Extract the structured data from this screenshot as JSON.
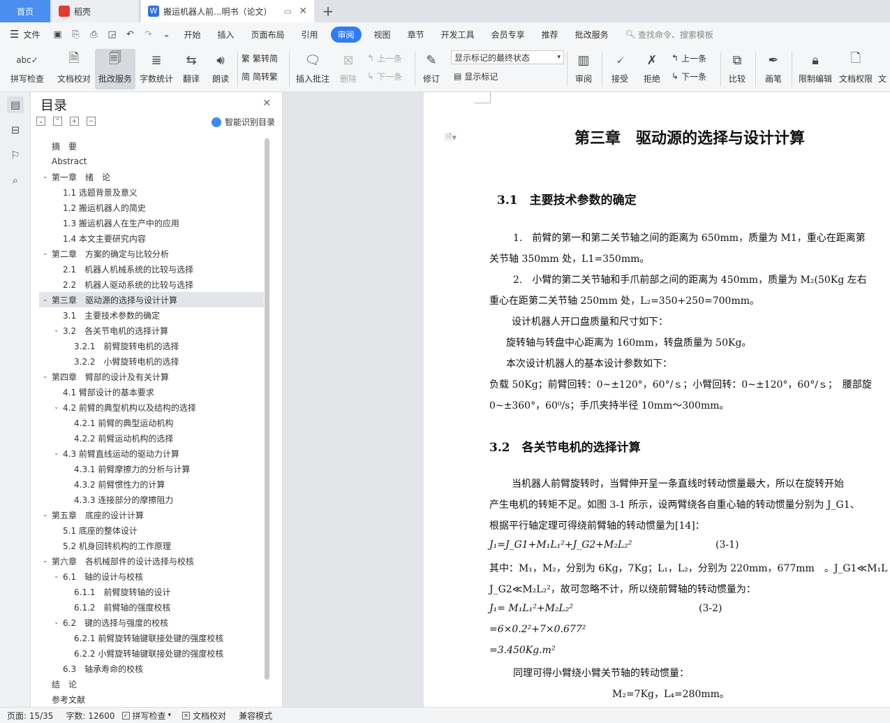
{
  "tabs": {
    "home": "首页",
    "daoke": "稻壳",
    "doc": "搬运机器人前...明书（论文）",
    "plus": "+"
  },
  "menu": {
    "file": "文件",
    "items": [
      "开始",
      "插入",
      "页面布局",
      "引用",
      "审阅",
      "视图",
      "章节",
      "开发工具",
      "会员专享",
      "推荐",
      "批改服务"
    ],
    "search": "查找命令、搜索模板"
  },
  "ribbon": {
    "spell": "拼写检查",
    "doccheck": "文档校对",
    "pigai": "批改服务",
    "wordcount": "字数统计",
    "translate": "翻译",
    "read": "朗读",
    "trad": "繁转简",
    "simp": "简转繁",
    "addcomment": "插入批注",
    "delete": "删除",
    "prev": "上一条",
    "next": "下一条",
    "revise": "修订",
    "markup_select": "显示标记的最终状态",
    "showmark": "显示标记",
    "review": "审阅",
    "accept": "接受",
    "reject": "拒绝",
    "prev2": "上一条",
    "next2": "下一条",
    "compare": "比较",
    "pen": "画笔",
    "restrict": "限制编辑",
    "docperm": "文档权限",
    "cut": "文"
  },
  "toc": {
    "title": "目录",
    "smart": "智能识别目录",
    "items": [
      {
        "text": "摘　要",
        "lvl": 0,
        "arrow": ""
      },
      {
        "text": "Abstract",
        "lvl": 0,
        "arrow": ""
      },
      {
        "text": "第一章　绪　论",
        "lvl": 0,
        "arrow": "v"
      },
      {
        "text": "1.1 选题背景及意义",
        "lvl": 1,
        "arrow": ""
      },
      {
        "text": "1.2  搬运机器人的简史",
        "lvl": 1,
        "arrow": ""
      },
      {
        "text": "1.3 搬运机器人在生产中的应用",
        "lvl": 1,
        "arrow": ""
      },
      {
        "text": "1.4 本文主要研究内容",
        "lvl": 1,
        "arrow": ""
      },
      {
        "text": "第二章　方案的确定与比较分析",
        "lvl": 0,
        "arrow": "v"
      },
      {
        "text": "2.1　机器人机械系统的比较与选择",
        "lvl": 1,
        "arrow": ""
      },
      {
        "text": "2.2　机器人驱动系统的比较与选择",
        "lvl": 1,
        "arrow": ""
      },
      {
        "text": "第三章　驱动源的选择与设计计算",
        "lvl": 0,
        "arrow": "v"
      },
      {
        "text": "3.1　主要技术参数的确定",
        "lvl": 1,
        "arrow": ""
      },
      {
        "text": "3.2　各关节电机的选择计算",
        "lvl": 1,
        "arrow": "v"
      },
      {
        "text": "3.2.1　前臂旋转电机的选择",
        "lvl": 2,
        "arrow": ""
      },
      {
        "text": "3.2.2　小臂旋转电机的选择",
        "lvl": 2,
        "arrow": ""
      },
      {
        "text": "第四章　臂部的设计及有关计算",
        "lvl": 0,
        "arrow": "v"
      },
      {
        "text": "4.1  臂部设计的基本要求",
        "lvl": 1,
        "arrow": ""
      },
      {
        "text": "4.2  前臂的典型机构以及结构的选择",
        "lvl": 1,
        "arrow": "v"
      },
      {
        "text": "4.2.1  前臂的典型运动机构",
        "lvl": 2,
        "arrow": ""
      },
      {
        "text": "4.2.2  前臂运动机构的选择",
        "lvl": 2,
        "arrow": ""
      },
      {
        "text": "4.3  前臂直线运动的驱动力计算",
        "lvl": 1,
        "arrow": "v"
      },
      {
        "text": "4.3.1  前臂摩擦力的分析与计算",
        "lvl": 2,
        "arrow": ""
      },
      {
        "text": "4.3.2  前臂惯性力的计算",
        "lvl": 2,
        "arrow": ""
      },
      {
        "text": "4.3.3 连接部分的摩擦阻力",
        "lvl": 2,
        "arrow": ""
      },
      {
        "text": "第五章　底座的设计计算",
        "lvl": 0,
        "arrow": "v"
      },
      {
        "text": "5.1  底座的整体设计",
        "lvl": 1,
        "arrow": ""
      },
      {
        "text": "5.2  机身回转机构的工作原理",
        "lvl": 1,
        "arrow": ""
      },
      {
        "text": "第六章　各机械部件的设计选择与校核",
        "lvl": 0,
        "arrow": "v"
      },
      {
        "text": "6.1　轴的设计与校核",
        "lvl": 1,
        "arrow": "v"
      },
      {
        "text": "6.1.1　前臂旋转轴的设计",
        "lvl": 2,
        "arrow": ""
      },
      {
        "text": "6.1.2　前臂轴的强度校核",
        "lvl": 2,
        "arrow": ""
      },
      {
        "text": "6.2　键的选择与强度的校核",
        "lvl": 1,
        "arrow": "v"
      },
      {
        "text": "6.2.1 前臂旋转轴键联接处键的强度校核",
        "lvl": 2,
        "arrow": ""
      },
      {
        "text": "6.2.2 小臂旋转轴键联接处键的强度校核",
        "lvl": 2,
        "arrow": ""
      },
      {
        "text": "6.3　轴承寿命的校核",
        "lvl": 1,
        "arrow": ""
      },
      {
        "text": "结　论",
        "lvl": 0,
        "arrow": ""
      },
      {
        "text": "参考文献",
        "lvl": 0,
        "arrow": ""
      }
    ]
  },
  "doc": {
    "chapter": "第三章　驱动源的选择与设计计算",
    "s31": "3.1　主要技术参数的确定",
    "p1": "1.　前臂的第一和第二关节轴之间的距离为 650mm，质量为 M1，重心在距离第",
    "p1b": "关节轴 350mm 处，L1=350mm。",
    "p2": "2.　小臂的第二关节轴和手爪前部之间的距离为 450mm，质量为 M₂(50Kg 左右",
    "p2b": "重心在距第二关节轴 250mm 处，L₂=350+250=700mm。",
    "p3": "设计机器人开口盘质量和尺寸如下：",
    "p4": "旋转轴与转盘中心距离为 160mm，转盘质量为 50Kg。",
    "p5": "本次设计机器人的基本设计参数如下：",
    "p6": "负载 50Kg；前臂回转：0~±120°，60°/ｓ；小臂回转：0~±120°，60°/ｓ；　腰部旋",
    "p7": "0~±360°，60⁰/s；手爪夹持半径 10mm～300mm。",
    "s32": "3.2　各关节电机的选择计算",
    "p8": "当机器人前臂旋转时，当臂伸开呈一条直线时转动惯量最大，所以在旋转开始",
    "p9": "产生电机的转矩不足。如图 3-1 所示，设两臂绕各自重心轴的转动惯量分别为 J_G1、",
    "p10": "根据平行轴定理可得绕前臂轴的转动惯量为[14]：",
    "eq1": "J₁=J_G1+M₁L₁²+J_G2+M₂L₂²",
    "eq1n": "(3-1)",
    "p11": "其中：M₁，M₂，分别为 6Kg，7Kg；L₁，L₂，分别为 220mm，677mm　。J_G1≪M₁L",
    "p12": "J_G2≪M₂L₂²，故可忽略不计，所以绕前臂轴的转动惯量为：",
    "eq2": "J₁= M₁L₁²+M₂L₂²",
    "eq2n": "(3-2)",
    "eq3": "=6×0.2²+7×0.677²",
    "eq4": "=3.450Kg.m²",
    "p13": "同理可得小臂绕小臂关节轴的转动惯量：",
    "p14": "M₂=7Kg，L₄=280mm。"
  },
  "status": {
    "page": "页面: 15/35",
    "words": "字数: 12600",
    "spell": "拼写检查",
    "check": "文档校对",
    "compat": "兼容模式"
  }
}
